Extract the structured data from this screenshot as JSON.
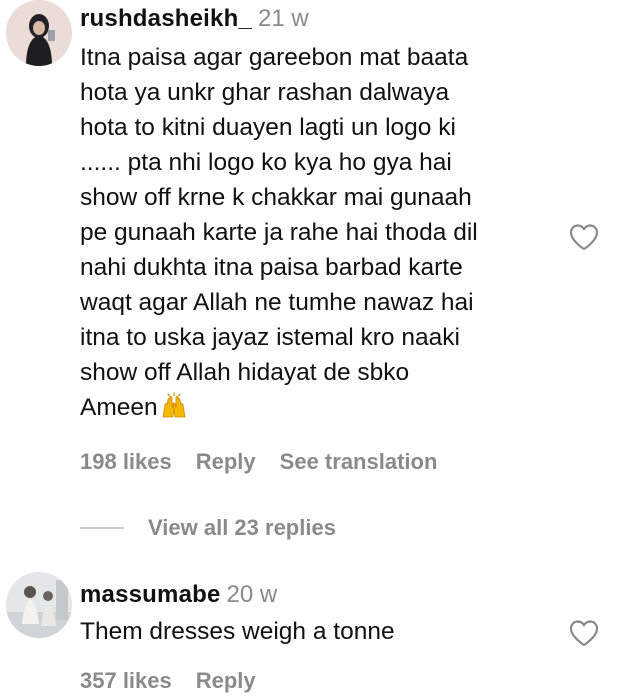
{
  "comments": [
    {
      "username": "rushdasheikh_",
      "time": "21 w",
      "text": "Itna paisa agar gareebon mat baata\nhota ya unkr ghar rashan dalwaya\nhota to kitni duayen lagti un logo ki\n...... pta nhi logo ko kya ho gya hai\nshow off krne k chakkar mai gunaah\npe gunaah karte ja rahe hai thoda dil\nnahi dukhta itna paisa barbad karte\nwaqt agar Allah ne tumhe nawaz hai\nitna to uska jayaz istemal kro naaki\nshow off Allah hidayat de sbko\nAmeen",
      "emoji": "raising-hands",
      "likes": "198 likes",
      "reply": "Reply",
      "translate": "See translation",
      "view_replies": "View all 23 replies"
    },
    {
      "username": "massumabe",
      "time": "20 w",
      "text": "Them dresses weigh a tonne",
      "likes": "357 likes",
      "reply": "Reply"
    }
  ],
  "colors": {
    "text": "#111111",
    "muted": "#8a8a8a",
    "divider": "#c9c9c9"
  }
}
